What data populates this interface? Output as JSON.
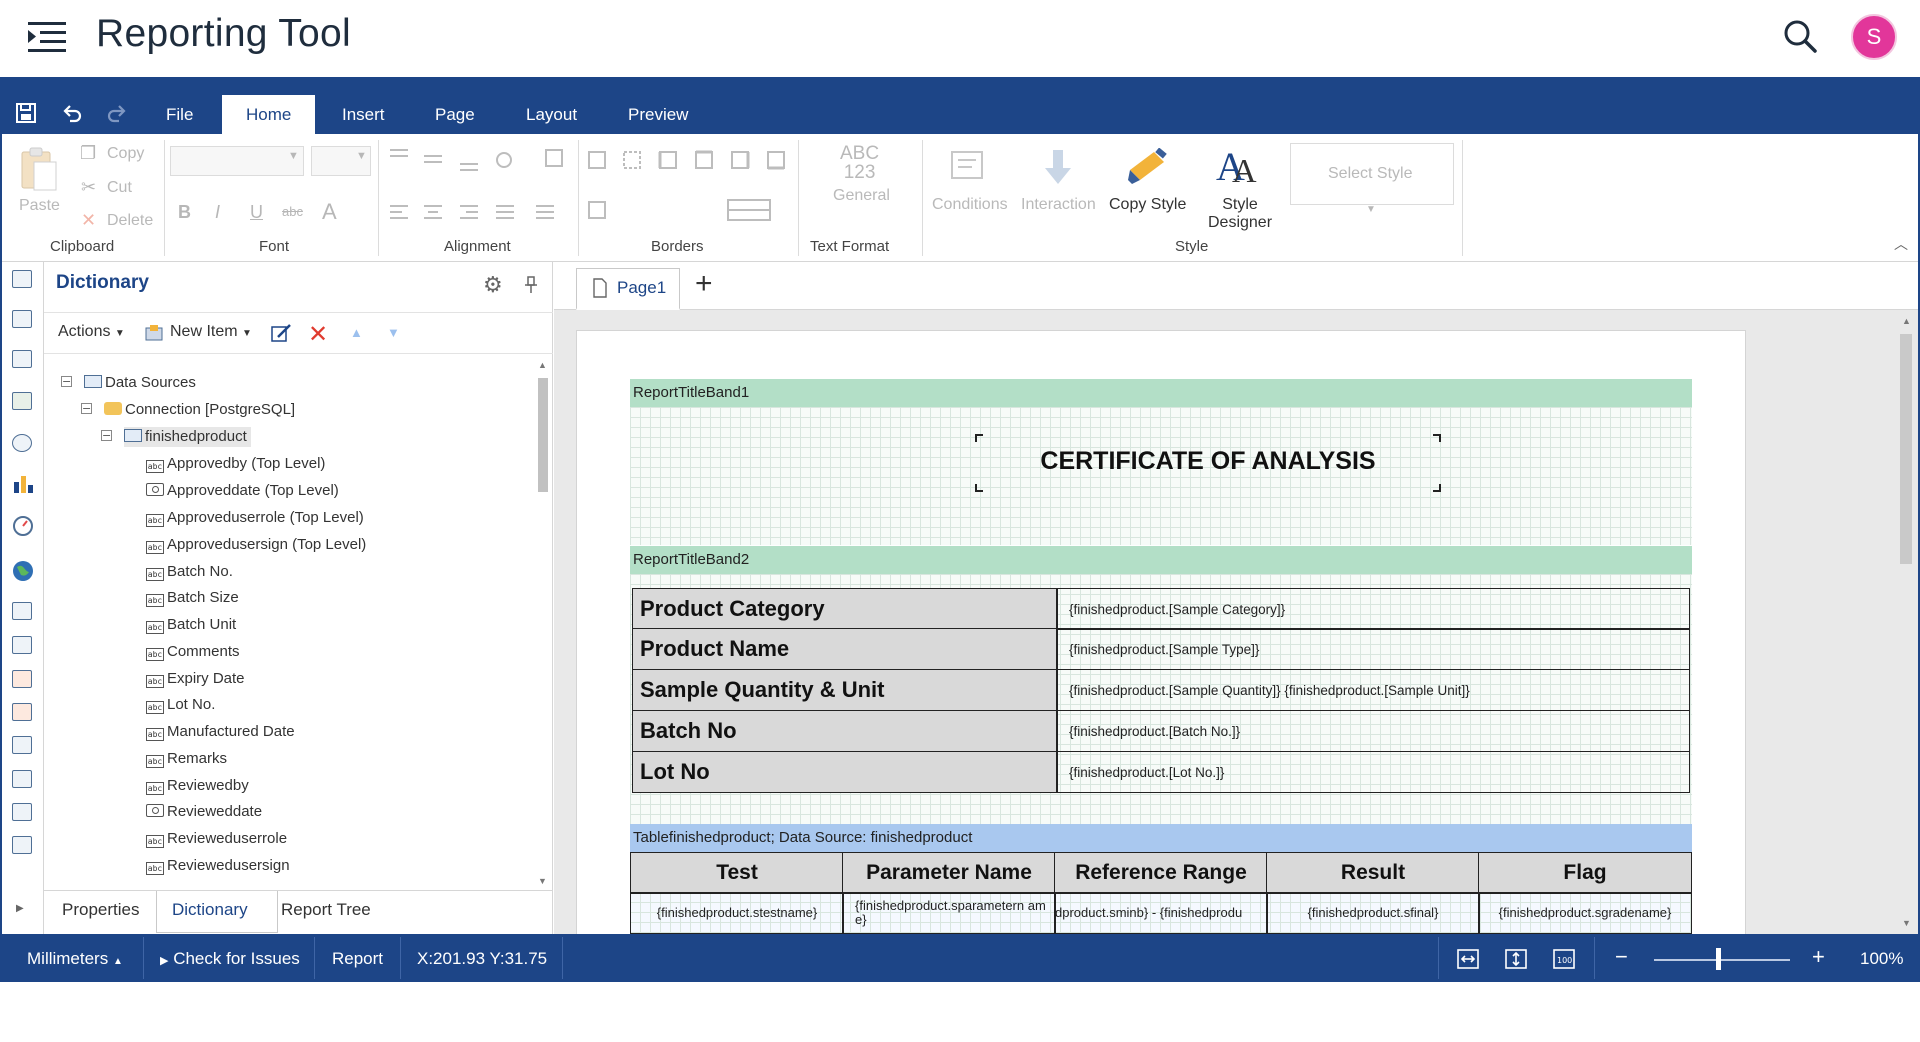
{
  "app": {
    "title": "Reporting Tool",
    "avatar_initial": "S"
  },
  "ribbon": {
    "tabs": [
      "File",
      "Home",
      "Insert",
      "Page",
      "Layout",
      "Preview"
    ],
    "active_tab": "Home",
    "clipboard": {
      "paste": "Paste",
      "copy": "Copy",
      "cut": "Cut",
      "delete": "Delete",
      "label": "Clipboard"
    },
    "font": {
      "label": "Font"
    },
    "alignment": {
      "label": "Alignment"
    },
    "borders": {
      "label": "Borders"
    },
    "text_format": {
      "label": "Text Format",
      "icon_text_1": "ABC",
      "icon_text_2": "123",
      "value": "General"
    },
    "style": {
      "label": "Style",
      "conditions": "Conditions",
      "interaction": "Interaction",
      "copy_style": "Copy Style",
      "style_designer_1": "Style",
      "style_designer_2": "Designer",
      "select_style": "Select Style"
    }
  },
  "dictionary": {
    "title": "Dictionary",
    "toolbar": {
      "actions": "Actions",
      "new_item": "New Item"
    },
    "tree": {
      "data_sources": "Data Sources",
      "connection": "Connection [PostgreSQL]",
      "table": "finishedproduct",
      "fields": [
        {
          "label": "Approvedby (Top Level)",
          "icon": "text-field-icon"
        },
        {
          "label": "Approveddate (Top Level)",
          "icon": "datetime-field-icon"
        },
        {
          "label": "Approveduserrole (Top Level)",
          "icon": "text-field-icon"
        },
        {
          "label": "Approvedusersign (Top Level)",
          "icon": "text-field-icon"
        },
        {
          "label": "Batch No.",
          "icon": "text-field-icon"
        },
        {
          "label": "Batch Size",
          "icon": "text-field-icon"
        },
        {
          "label": "Batch Unit",
          "icon": "text-field-icon"
        },
        {
          "label": "Comments",
          "icon": "text-field-icon"
        },
        {
          "label": "Expiry Date",
          "icon": "text-field-icon"
        },
        {
          "label": "Lot No.",
          "icon": "text-field-icon"
        },
        {
          "label": "Manufactured Date",
          "icon": "text-field-icon"
        },
        {
          "label": "Remarks",
          "icon": "text-field-icon"
        },
        {
          "label": "Reviewedby",
          "icon": "text-field-icon"
        },
        {
          "label": "Revieweddate",
          "icon": "datetime-field-icon"
        },
        {
          "label": "Revieweduserrole",
          "icon": "text-field-icon"
        },
        {
          "label": "Reviewedusersign",
          "icon": "text-field-icon"
        }
      ]
    },
    "bottom_tabs": [
      "Properties",
      "Dictionary",
      "Report Tree"
    ],
    "active_bottom_tab": "Dictionary"
  },
  "designer": {
    "page_tab": "Page1",
    "bands": {
      "title1": "ReportTitleBand1",
      "title2": "ReportTitleBand2",
      "table_band": "Tablefinishedproduct; Data Source: finishedproduct"
    },
    "heading": "CERTIFICATE OF ANALYSIS",
    "info_rows": [
      {
        "label": "Product Category",
        "value": "{finishedproduct.[Sample Category]}"
      },
      {
        "label": "Product Name",
        "value": "{finishedproduct.[Sample Type]}"
      },
      {
        "label": "Sample Quantity & Unit",
        "value": "{finishedproduct.[Sample Quantity]} {finishedproduct.[Sample Unit]}"
      },
      {
        "label": "Batch No",
        "value": "{finishedproduct.[Batch No.]}"
      },
      {
        "label": "Lot No",
        "value": "{finishedproduct.[Lot No.]}"
      }
    ],
    "table_headers": [
      "Test",
      "Parameter Name",
      "Reference Range",
      "Result",
      "Flag"
    ],
    "table_row": [
      "{finishedproduct.stestname}",
      "{finishedproduct.sparametern ame}",
      "dproduct.sminb} - {finishedprodu",
      "{finishedproduct.sfinal}",
      "{finishedproduct.sgradename}"
    ]
  },
  "statusbar": {
    "units": "Millimeters",
    "check": "Check for Issues",
    "report": "Report",
    "coords": "X:201.93 Y:31.75",
    "zoom_percent": "100%",
    "zoom_value": 100
  },
  "colors": {
    "brand": "#1d4587",
    "avatar": "#e2369a",
    "band_green": "#b3dfc7",
    "band_blue": "#a9c8ef",
    "table_header": "#d9d9d9"
  }
}
